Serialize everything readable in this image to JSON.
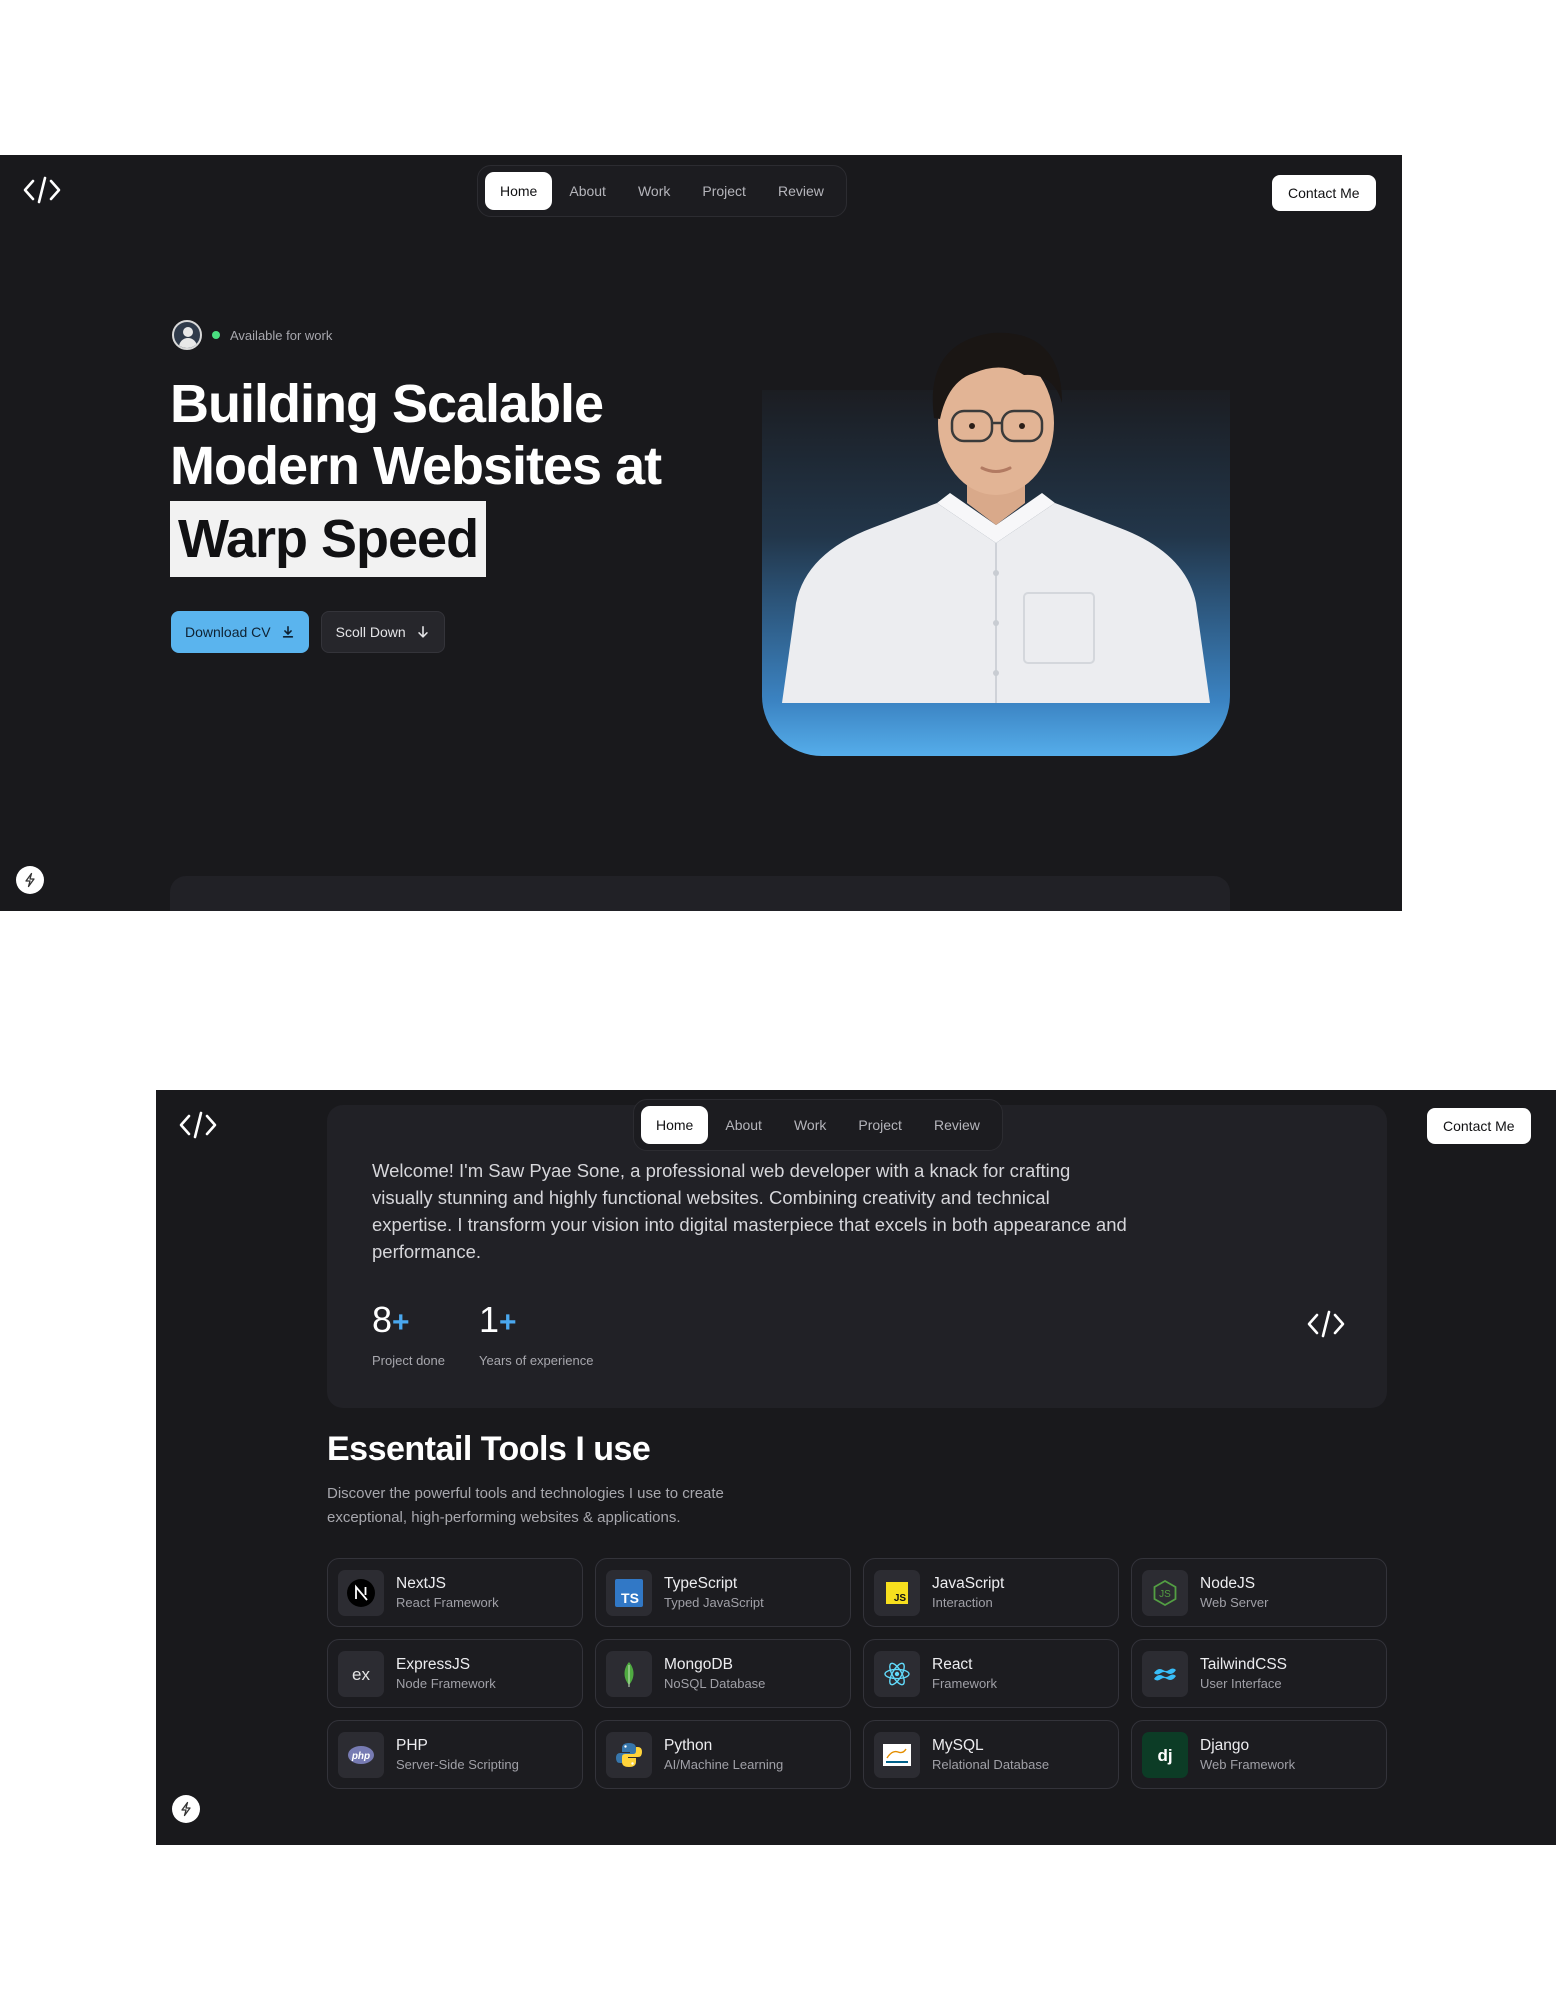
{
  "hero_screen": {
    "nav": {
      "items": [
        {
          "label": "Home",
          "active": true
        },
        {
          "label": "About",
          "active": false
        },
        {
          "label": "Work",
          "active": false
        },
        {
          "label": "Project",
          "active": false
        },
        {
          "label": "Review",
          "active": false
        }
      ],
      "contact_label": "Contact Me"
    },
    "status_text": "Available for work",
    "headline": {
      "line1": "Building Scalable",
      "line2": "Modern Websites at",
      "highlight": "Warp Speed"
    },
    "buttons": {
      "download_cv": "Download CV",
      "scroll_down": "Scoll Down"
    }
  },
  "about_screen": {
    "nav": {
      "items": [
        {
          "label": "Home",
          "active": true
        },
        {
          "label": "About",
          "active": false
        },
        {
          "label": "Work",
          "active": false
        },
        {
          "label": "Project",
          "active": false
        },
        {
          "label": "Review",
          "active": false
        }
      ],
      "contact_label": "Contact Me"
    },
    "intro": "Welcome! I'm Saw Pyae Sone, a professional web developer with a knack for crafting visually stunning and highly functional websites. Combining creativity and technical expertise. I transform your vision into digital masterpiece that excels in both appearance and performance.",
    "stats": [
      {
        "value": "8",
        "suffix": "+",
        "label": "Project done"
      },
      {
        "value": "1",
        "suffix": "+",
        "label": "Years of experience"
      }
    ],
    "tools_section": {
      "title": "Essentail Tools I use",
      "description": "Discover the powerful tools and technologies I use to create exceptional, high-performing websites & applications.",
      "tools": [
        {
          "name": "NextJS",
          "subtitle": "React Framework",
          "icon": "nextjs-icon"
        },
        {
          "name": "TypeScript",
          "subtitle": "Typed JavaScript",
          "icon": "typescript-icon"
        },
        {
          "name": "JavaScript",
          "subtitle": "Interaction",
          "icon": "javascript-icon"
        },
        {
          "name": "NodeJS",
          "subtitle": "Web Server",
          "icon": "nodejs-icon"
        },
        {
          "name": "ExpressJS",
          "subtitle": "Node Framework",
          "icon": "expressjs-icon"
        },
        {
          "name": "MongoDB",
          "subtitle": "NoSQL Database",
          "icon": "mongodb-icon"
        },
        {
          "name": "React",
          "subtitle": "Framework",
          "icon": "react-icon"
        },
        {
          "name": "TailwindCSS",
          "subtitle": "User Interface",
          "icon": "tailwindcss-icon"
        },
        {
          "name": "PHP",
          "subtitle": "Server-Side Scripting",
          "icon": "php-icon"
        },
        {
          "name": "Python",
          "subtitle": "AI/Machine Learning",
          "icon": "python-icon"
        },
        {
          "name": "MySQL",
          "subtitle": "Relational Database",
          "icon": "mysql-icon"
        },
        {
          "name": "Django",
          "subtitle": "Web Framework",
          "icon": "django-icon"
        }
      ]
    }
  },
  "colors": {
    "background": "#19191c",
    "card": "#212126",
    "accent_blue": "#5ab4ee",
    "stat_plus": "#4aa8ef",
    "status_dot": "#4ade80"
  }
}
